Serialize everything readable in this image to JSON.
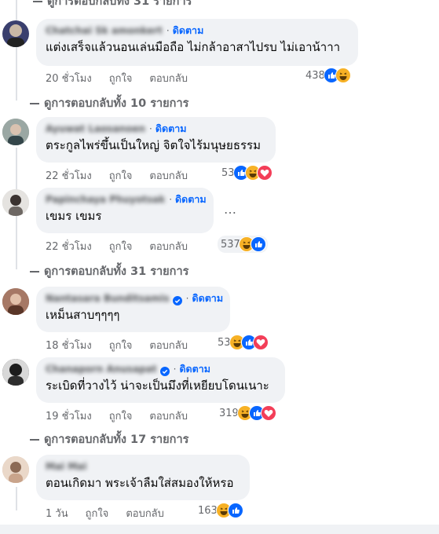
{
  "top_replies": "ดูการตอบกลับทั้ง 31 รายการ",
  "comments": [
    {
      "name": "Chatchai Sk amonkert",
      "follow": "ดิดตาม",
      "text": "แต่งเสร็จแล้วนอนเล่นมือถือ ไม่กล้าอาสาไปรบ ไม่เอาน้าาา",
      "time": "20 ชั่วโมง",
      "like": "ถูกใจ",
      "reply": "ตอบกลับ",
      "count": "438",
      "reactions": [
        "like",
        "haha"
      ],
      "avatar_color": "#3a3f6e",
      "verified": false
    },
    {
      "name": "Ayuwat Laosanoen",
      "follow": "ดิดตาม",
      "text": "ตระกูลไพร่ขึ้นเป็นใหญ่ จิตใจไร้มนุษยธรรม",
      "time": "22 ชั่วโมง",
      "like": "ถูกใจ",
      "reply": "ตอบกลับ",
      "count": "53",
      "reactions": [
        "like",
        "haha",
        "love"
      ],
      "avatar_color": "#7c8a86",
      "verified": false
    },
    {
      "name": "Papinchaya Phuyotsak",
      "follow": "ดิดตาม",
      "text": "เขมร เขมร",
      "time": "22 ชั่วโมง",
      "like": "ถูกใจ",
      "reply": "ตอบกลับ",
      "count": "537",
      "reactions": [
        "haha",
        "like"
      ],
      "avatar_color": "#c9c9c9",
      "verified": false
    },
    {
      "name": "Nantasara Bunditsamis",
      "follow": "ดิดตาม",
      "text": "เหม็นสาบๆๆๆๆ",
      "time": "18 ชั่วโมง",
      "like": "ถูกใจ",
      "reply": "ตอบกลับ",
      "count": "53",
      "reactions": [
        "haha",
        "like",
        "love"
      ],
      "avatar_color": "#8a5a48",
      "verified": true
    },
    {
      "name": "Chanaporn Anusapat",
      "follow": "ดิดตาม",
      "text": "ระเบิดที่วางไว้ น่าจะเป็นมึงที่เหยียบโดนเนาะ",
      "time": "19 ชั่วโมง",
      "like": "ถูกใจ",
      "reply": "ตอบกลับ",
      "count": "319",
      "reactions": [
        "haha",
        "like",
        "love"
      ],
      "avatar_color": "#2c2c2c",
      "verified": true
    },
    {
      "name": "Mai Mai",
      "follow": "",
      "text": "ตอนเกิดมา พระเจ้าลืมใส่สมองให้หรอ",
      "time": "1 วัน",
      "like": "ถูกใจ",
      "reply": "ตอบกลับ",
      "count": "163",
      "reactions": [
        "haha",
        "like"
      ],
      "avatar_color": "#d7b9a4",
      "verified": false
    }
  ],
  "reply_threads": [
    "ดูการตอบกลับทั้ง 10 รายการ",
    "ดูการตอบกลับทั้ง 31 รายการ",
    "ดูการตอบกลับทั้ง 17 รายการ"
  ],
  "more_label": "…",
  "colors": {
    "accent": "#0866ff",
    "bubble": "#f0f2f5",
    "muted": "#65676b",
    "love": "#f33e58",
    "haha": "#f7b125"
  }
}
